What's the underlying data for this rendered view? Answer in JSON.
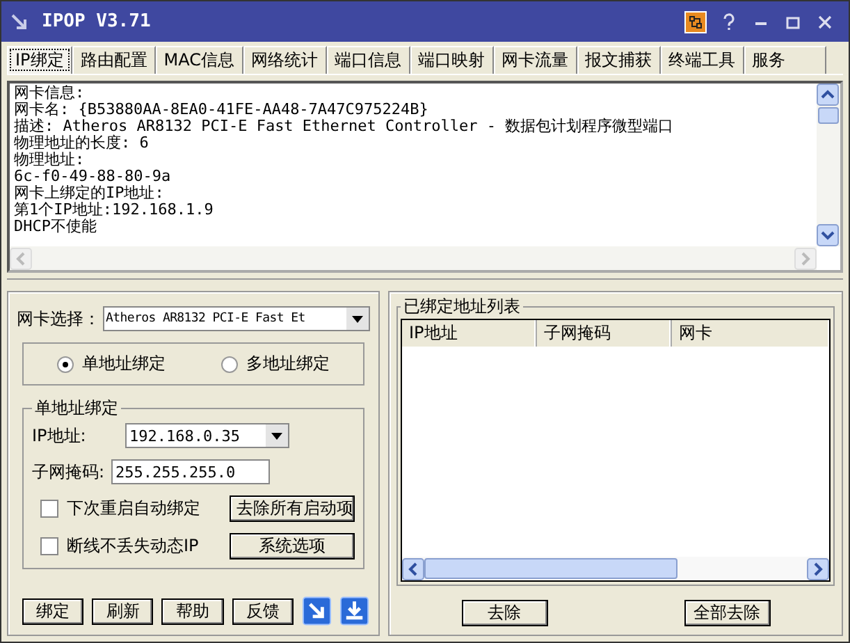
{
  "window": {
    "title": "IPOP V3.71"
  },
  "tabs": [
    {
      "label": "IP绑定",
      "selected": true
    },
    {
      "label": "路由配置",
      "selected": false
    },
    {
      "label": "MAC信息",
      "selected": false
    },
    {
      "label": "网络统计",
      "selected": false
    },
    {
      "label": "端口信息",
      "selected": false
    },
    {
      "label": "端口映射",
      "selected": false
    },
    {
      "label": "网卡流量",
      "selected": false
    },
    {
      "label": "报文捕获",
      "selected": false
    },
    {
      "label": "终端工具",
      "selected": false
    },
    {
      "label": "服务",
      "selected": false
    }
  ],
  "info_lines": [
    "网卡信息:",
    "网卡名: {B53880AA-8EA0-41FE-AA48-7A47C975224B}",
    "描述: Atheros AR8132 PCI-E Fast Ethernet Controller - 数据包计划程序微型端口",
    "物理地址的长度: 6",
    "物理地址:",
    "6c-f0-49-88-80-9a",
    "网卡上绑定的IP地址:",
    "第1个IP地址:192.168.1.9",
    "DHCP不使能"
  ],
  "adapter": {
    "label": "网卡选择：",
    "value": "Atheros AR8132 PCI-E Fast Et"
  },
  "modes": [
    {
      "label": "单地址绑定",
      "selected": true
    },
    {
      "label": "多地址绑定",
      "selected": false
    }
  ],
  "single_group": {
    "title": "单地址绑定",
    "ip_label": "IP地址:",
    "ip_value": "192.168.0.35",
    "mask_label": "子网掩码:",
    "mask_value": "255.255.255.0",
    "options": [
      {
        "label": "下次重启自动绑定",
        "checked": false,
        "button": "去除所有启动项"
      },
      {
        "label": "断线不丢失动态IP",
        "checked": false,
        "button": "系统选项"
      }
    ]
  },
  "buttons": [
    "绑定",
    "刷新",
    "帮助",
    "反馈"
  ],
  "bound_list": {
    "title": "已绑定地址列表",
    "columns": [
      "IP地址",
      "子网掩码",
      "网卡"
    ],
    "buttons": [
      "去除",
      "全部去除"
    ]
  }
}
